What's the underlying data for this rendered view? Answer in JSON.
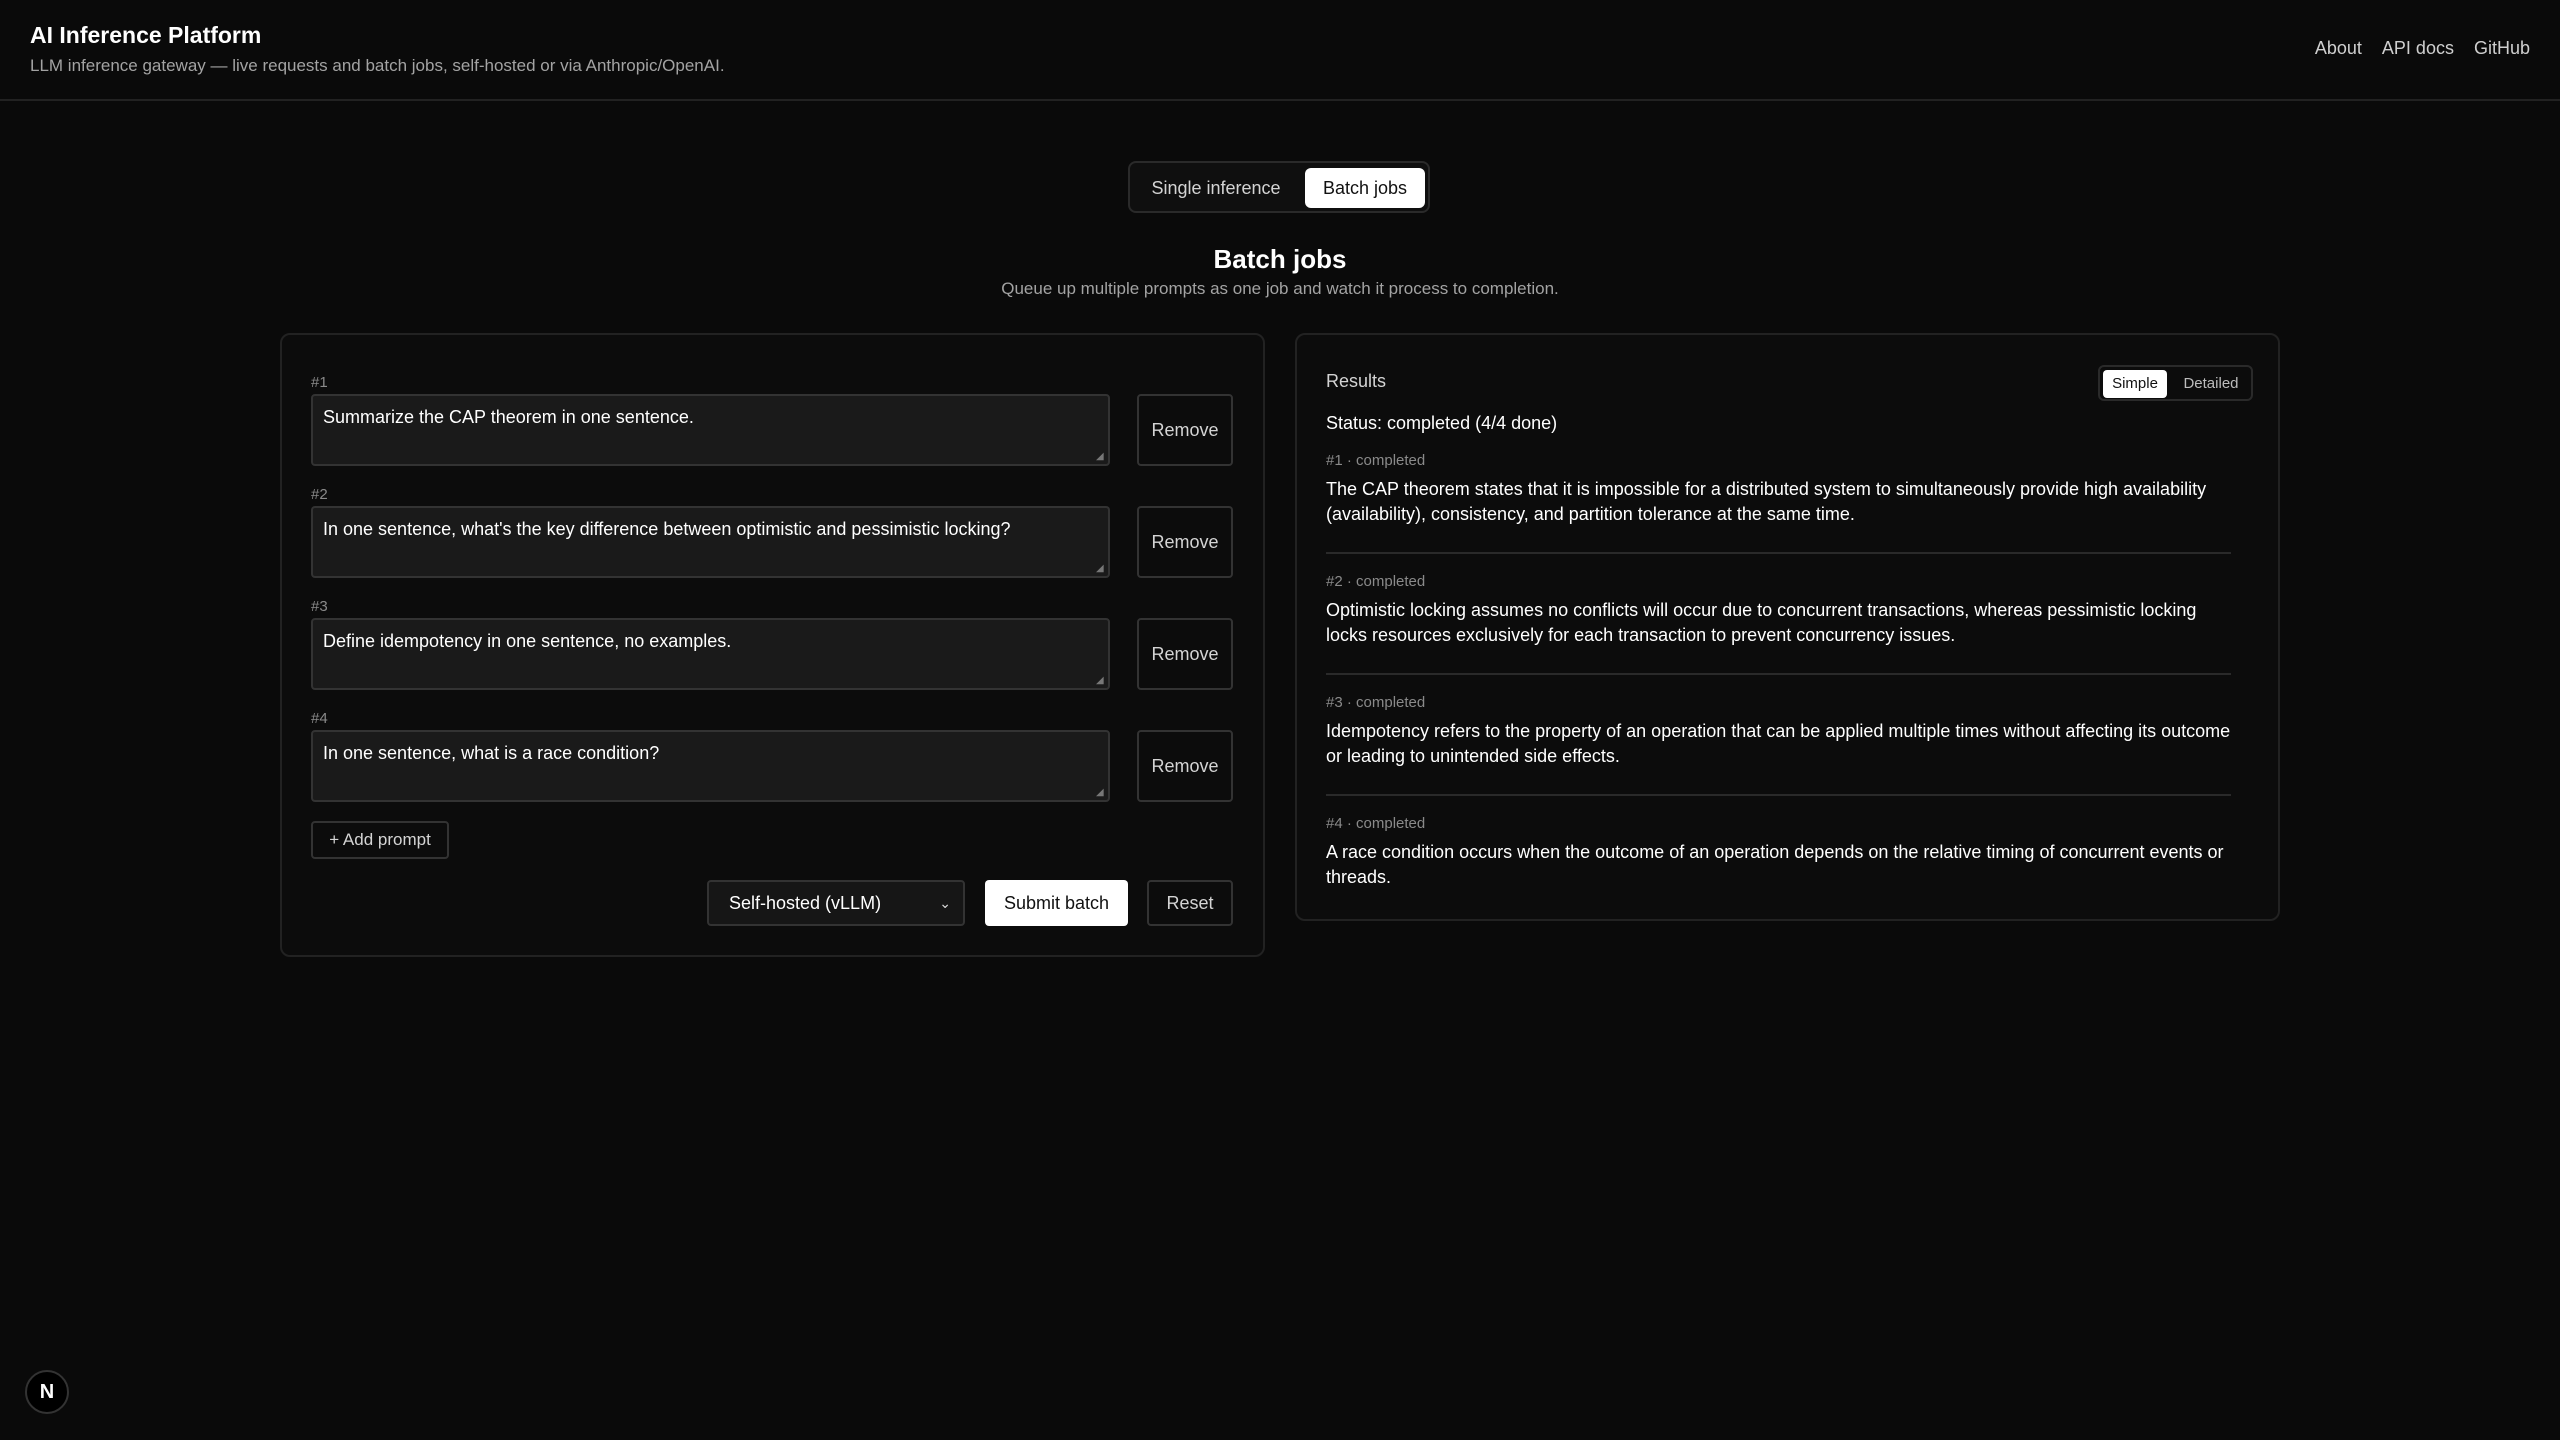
{
  "header": {
    "title": "AI Inference Platform",
    "subtitle": "LLM inference gateway — live requests and batch jobs, self-hosted or via Anthropic/OpenAI.",
    "nav": [
      "About",
      "API docs",
      "GitHub"
    ]
  },
  "tabs": {
    "single": "Single inference",
    "batch": "Batch jobs",
    "active": "batch"
  },
  "section": {
    "title": "Batch jobs",
    "subtitle": "Queue up multiple prompts as one job and watch it process to completion."
  },
  "prompts": [
    {
      "label": "#1",
      "text": "Summarize the CAP theorem in one sentence."
    },
    {
      "label": "#2",
      "text": "In one sentence, what's the key difference between optimistic and pessimistic locking?"
    },
    {
      "label": "#3",
      "text": "Define idempotency in one sentence, no examples."
    },
    {
      "label": "#4",
      "text": "In one sentence, what is a race condition?"
    }
  ],
  "actions": {
    "remove": "Remove",
    "add_prompt": "+ Add prompt",
    "provider_selected": "Self-hosted (vLLM)",
    "submit": "Submit batch",
    "reset": "Reset"
  },
  "results": {
    "title": "Results",
    "modes": {
      "simple": "Simple",
      "detailed": "Detailed",
      "active": "simple"
    },
    "status": "Status: completed (4/4 done)",
    "items": [
      {
        "meta": "#1 · completed",
        "text": "The CAP theorem states that it is impossible for a distributed system to simultaneously provide high availability (availability), consistency, and partition tolerance at the same time."
      },
      {
        "meta": "#2 · completed",
        "text": "Optimistic locking assumes no conflicts will occur due to concurrent transactions, whereas pessimistic locking locks resources exclusively for each transaction to prevent concurrency issues."
      },
      {
        "meta": "#3 · completed",
        "text": "Idempotency refers to the property of an operation that can be applied multiple times without affecting its outcome or leading to unintended side effects."
      },
      {
        "meta": "#4 · completed",
        "text": "A race condition occurs when the outcome of an operation depends on the relative timing of concurrent events or threads."
      }
    ]
  },
  "badge": {
    "letter": "N"
  }
}
